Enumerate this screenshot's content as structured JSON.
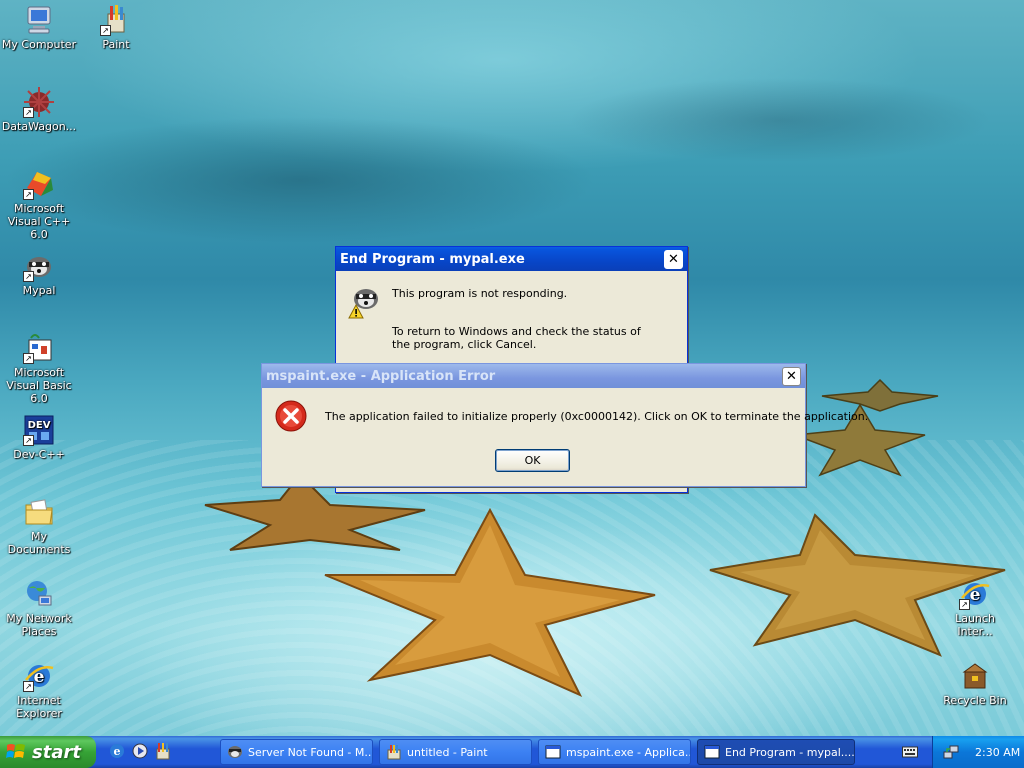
{
  "desktop": {
    "icons_left": [
      {
        "name": "my-computer",
        "label": "My Computer"
      },
      {
        "name": "datawagon",
        "label": "DataWagon..."
      },
      {
        "name": "visual-cpp",
        "label": "Microsoft Visual C++ 6.0"
      },
      {
        "name": "mypal",
        "label": "Mypal"
      },
      {
        "name": "visual-basic",
        "label": "Microsoft Visual Basic 6.0"
      },
      {
        "name": "dev-cpp",
        "label": "Dev-C++"
      },
      {
        "name": "my-documents",
        "label": "My Documents"
      },
      {
        "name": "my-network-places",
        "label": "My Network Places"
      },
      {
        "name": "internet-explorer",
        "label": "Internet Explorer"
      }
    ],
    "paint_label": "Paint",
    "launch_label": "Launch Inter...",
    "recycle_label": "Recycle Bin",
    "dev_badge": "DEV"
  },
  "end_program_dialog": {
    "title": "End Program - mypal.exe",
    "line1": "This program is not responding.",
    "line2": "To return to Windows and check the status of the program, click Cancel."
  },
  "error_dialog": {
    "title": "mspaint.exe - Application Error",
    "message": "The application failed to initialize properly (0xc0000142). Click on OK to terminate the application.",
    "ok_label": "OK"
  },
  "taskbar": {
    "start_label": "start",
    "tasks": [
      {
        "label": "Server Not Found - M..."
      },
      {
        "label": "untitled - Paint"
      },
      {
        "label": "mspaint.exe - Applica..."
      },
      {
        "label": "End Program - mypal...."
      }
    ],
    "clock": "2:30 AM"
  },
  "colors": {
    "xp_blue": "#0a5fe5",
    "start_green": "#36a336",
    "dialog_bg": "#ece9d8",
    "error_red": "#d42a1c"
  }
}
